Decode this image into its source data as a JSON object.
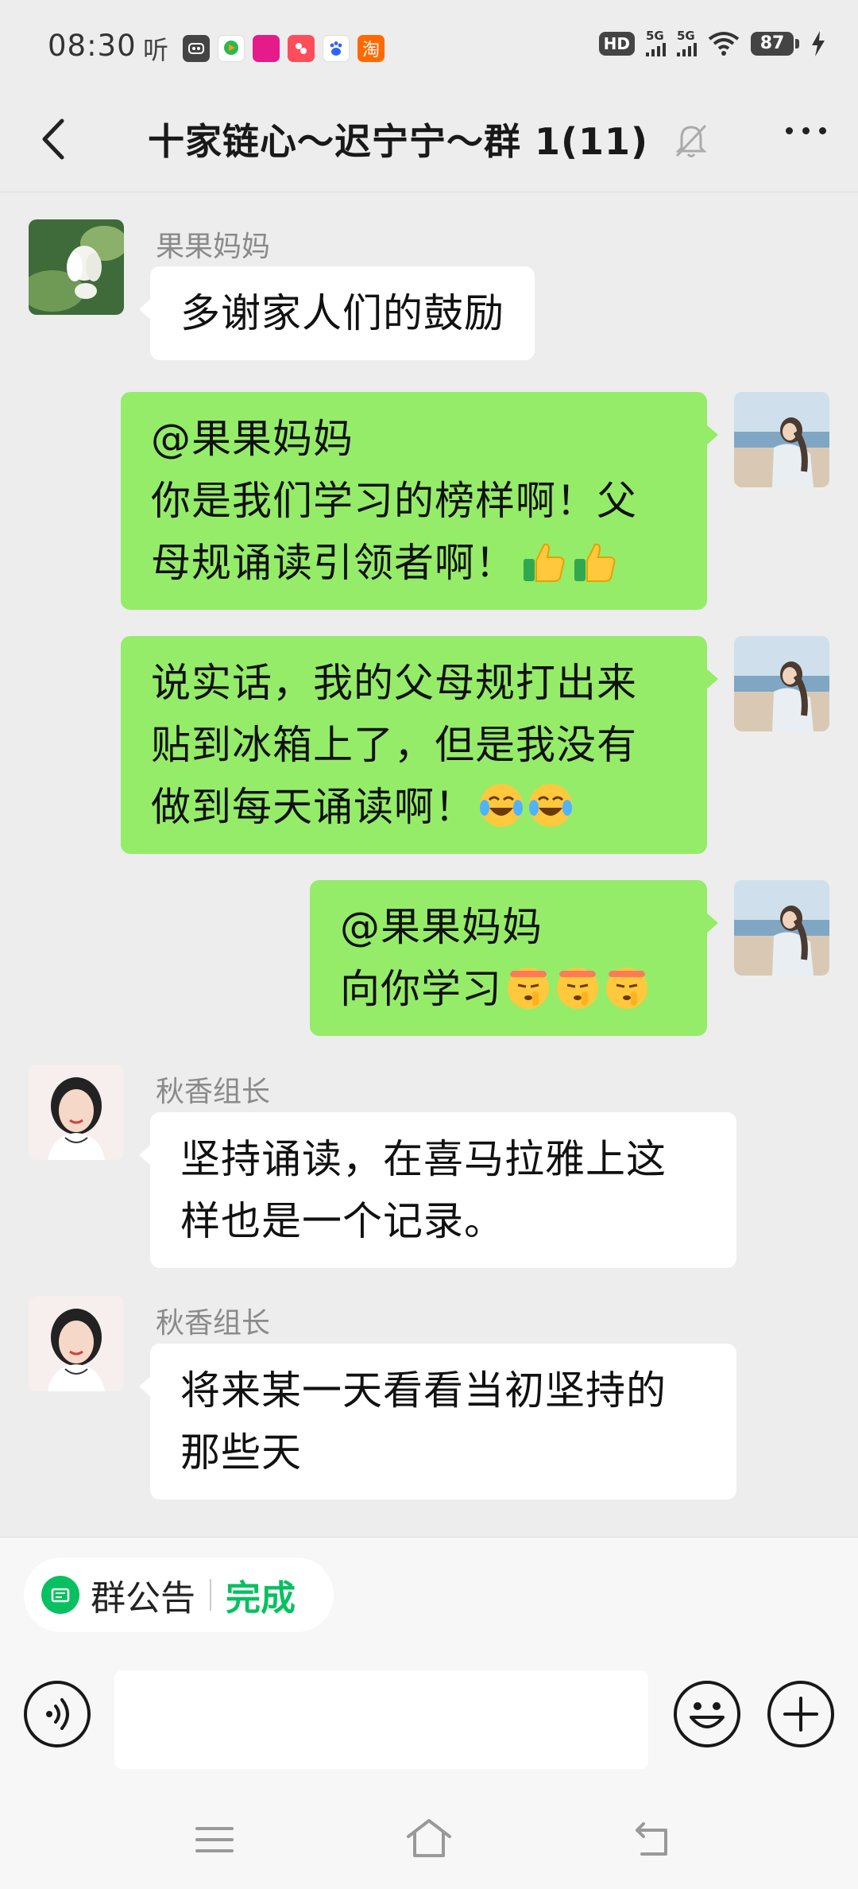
{
  "status": {
    "time": "08:30",
    "ting": "听",
    "taobao": "淘",
    "hd": "HD",
    "net1": "5G",
    "net2": "5G",
    "battery": "87"
  },
  "header": {
    "title": "十家链心～迟宁宁～群 1(11)"
  },
  "messages": [
    {
      "sender": "果果妈妈",
      "lines": [
        "多谢家人们的鼓励"
      ]
    },
    {
      "lines": [
        "@果果妈妈",
        "你是我们学习的榜样啊！父",
        "母规诵读引领者啊！"
      ]
    },
    {
      "lines": [
        "说实话，我的父母规打出来",
        "贴到冰箱上了，但是我没有",
        "做到每天诵读啊！"
      ]
    },
    {
      "lines": [
        "@果果妈妈",
        "向你学习"
      ]
    },
    {
      "sender": "秋香组长",
      "lines": [
        "坚持诵读，在喜马拉雅上这",
        "样也是一个记录。"
      ]
    },
    {
      "sender": "秋香组长",
      "lines": [
        "将来某一天看看当初坚持的",
        "那些天"
      ]
    }
  ],
  "notice": {
    "label": "群公告",
    "action": "完成"
  },
  "input": {
    "placeholder": ""
  },
  "colors": {
    "accent": "#07c160",
    "bubble_out": "#95ec69",
    "bubble_in": "#ffffff",
    "background": "#ededed"
  },
  "icons": [
    "back-icon",
    "mute-bell-icon",
    "more-icon",
    "voice-icon",
    "emoji-icon",
    "plus-icon",
    "menu-icon",
    "home-icon",
    "back-nav-icon"
  ]
}
